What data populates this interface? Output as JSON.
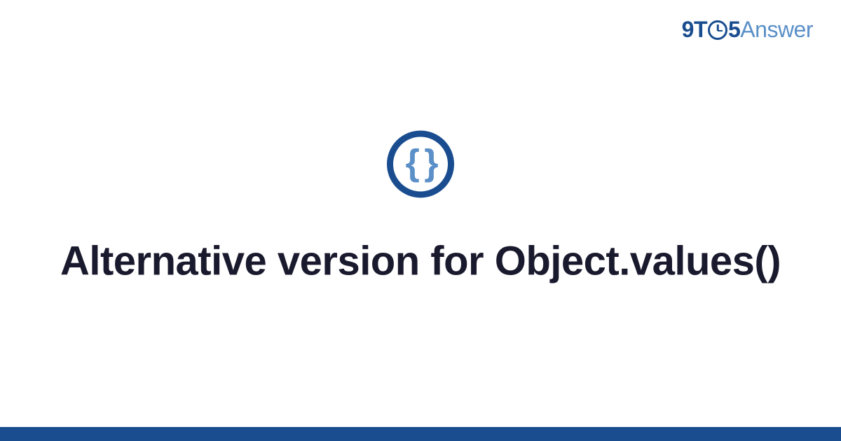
{
  "logo": {
    "part1": "9T",
    "part2": "5",
    "part3": "Answer"
  },
  "icon": {
    "braces": "{ }"
  },
  "title": "Alternative version for Object.values()",
  "colors": {
    "primary": "#1a4d8f",
    "secondary": "#5a8fc7",
    "text": "#1a1a2e"
  }
}
